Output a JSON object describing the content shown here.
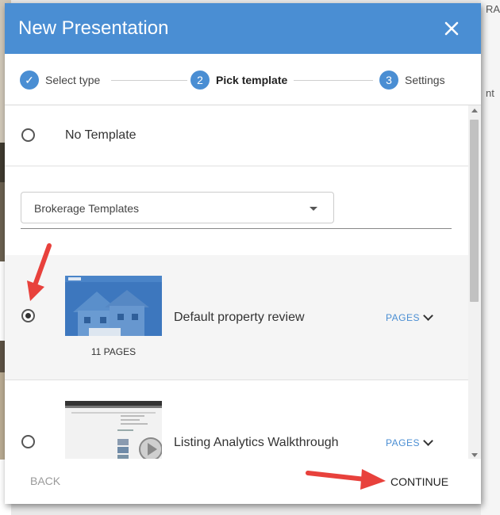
{
  "background": {
    "partial_text_top": "RA",
    "partial_text_mid": "nt"
  },
  "dialog": {
    "title": "New Presentation",
    "close_icon": "close-icon",
    "accent_color": "#4a8ed3"
  },
  "stepper": {
    "steps": [
      {
        "number": "✓",
        "label": "Select type",
        "state": "done"
      },
      {
        "number": "2",
        "label": "Pick template",
        "state": "active"
      },
      {
        "number": "3",
        "label": "Settings",
        "state": "upcoming"
      }
    ]
  },
  "options": {
    "no_template_label": "No Template",
    "template_group_select": {
      "value": "Brokerage Templates"
    },
    "templates": [
      {
        "name": "Default property review",
        "page_count": "11 PAGES",
        "pages_toggle": "PAGES",
        "selected": true
      },
      {
        "name": "Listing Analytics Walkthrough",
        "pages_toggle": "PAGES",
        "selected": false
      }
    ]
  },
  "footer": {
    "back_label": "BACK",
    "continue_label": "CONTINUE"
  },
  "annotation_arrow_color": "#e8413c"
}
